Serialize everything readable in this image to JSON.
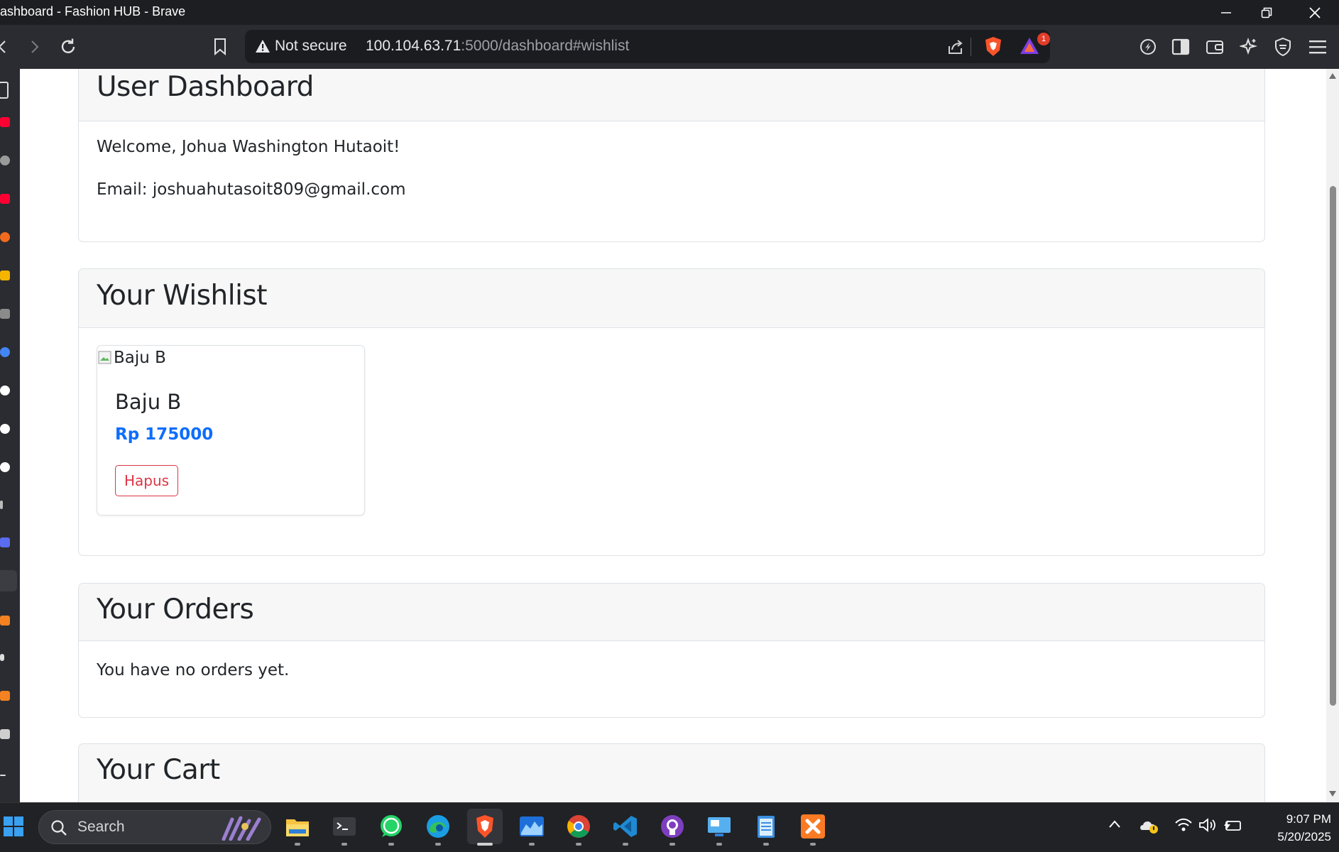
{
  "window": {
    "title": "ashboard - Fashion HUB - Brave"
  },
  "browser": {
    "security_label": "Not secure",
    "url_host": "100.104.63.71",
    "url_rest": ":5000/dashboard#wishlist",
    "notification_count": "1"
  },
  "dashboard": {
    "title": "User Dashboard",
    "welcome": "Welcome, Johua Washington Hutaoit!",
    "email": "Email: joshuahutasoit809@gmail.com"
  },
  "wishlist": {
    "title": "Your Wishlist",
    "items": [
      {
        "image_alt": "Baju B",
        "name": "Baju B",
        "price": "Rp 175000",
        "remove_label": "Hapus"
      }
    ]
  },
  "orders": {
    "title": "Your Orders",
    "empty_text": "You have no orders yet."
  },
  "cart": {
    "title": "Your Cart"
  },
  "taskbar": {
    "search_label": "Search",
    "time": "9:07 PM",
    "date": "5/20/2025"
  },
  "colors": {
    "price": "#0d6efd",
    "danger": "#dc3545",
    "card_header_bg": "#f7f7f7",
    "chrome_bg": "#2b2c31"
  }
}
